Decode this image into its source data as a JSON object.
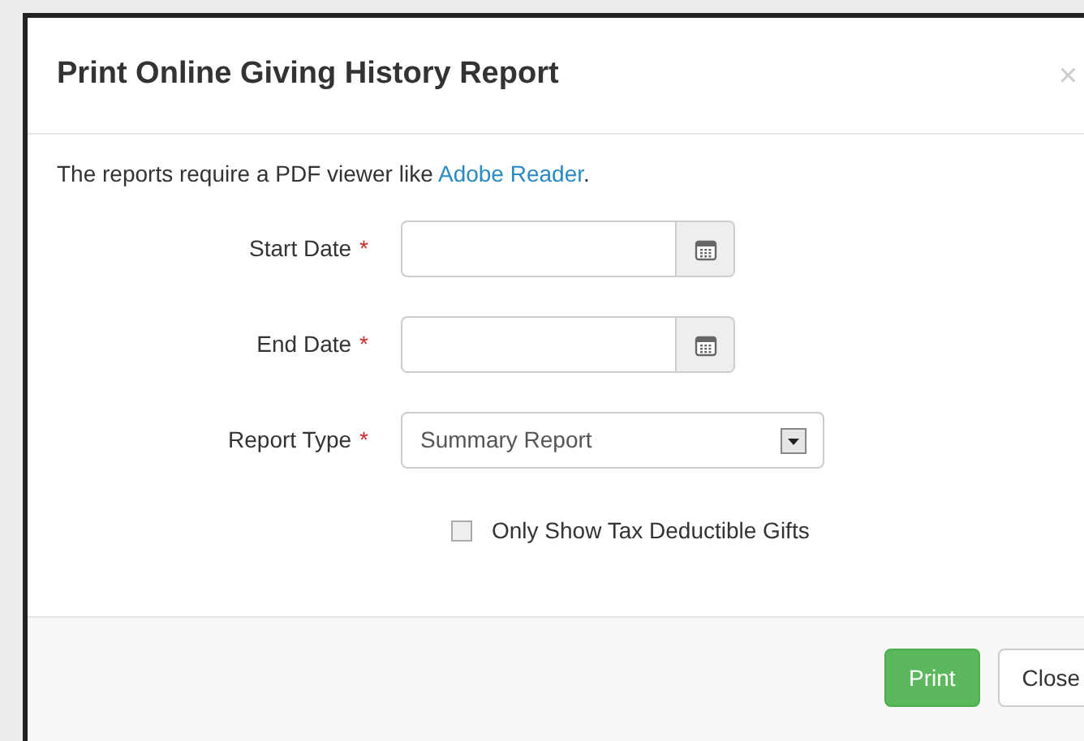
{
  "dialog": {
    "title": "Print Online Giving History Report",
    "close_icon": "×"
  },
  "notice": {
    "text": "The reports require a PDF viewer like ",
    "link": "Adobe Reader",
    "end": "."
  },
  "fields": [
    {
      "kind": "date",
      "label": "Start Date",
      "required_mark": "*"
    },
    {
      "kind": "date",
      "label": "End Date",
      "required_mark": "*"
    },
    {
      "kind": "select",
      "label": "Report Type",
      "required_mark": "*",
      "value": "Summary Report"
    }
  ],
  "checkbox": {
    "label": "Only Show Tax Deductible Gifts",
    "checked": false
  },
  "buttons": [
    {
      "kind": "primary",
      "label": "Print"
    },
    {
      "kind": "default",
      "label": "Close"
    }
  ]
}
